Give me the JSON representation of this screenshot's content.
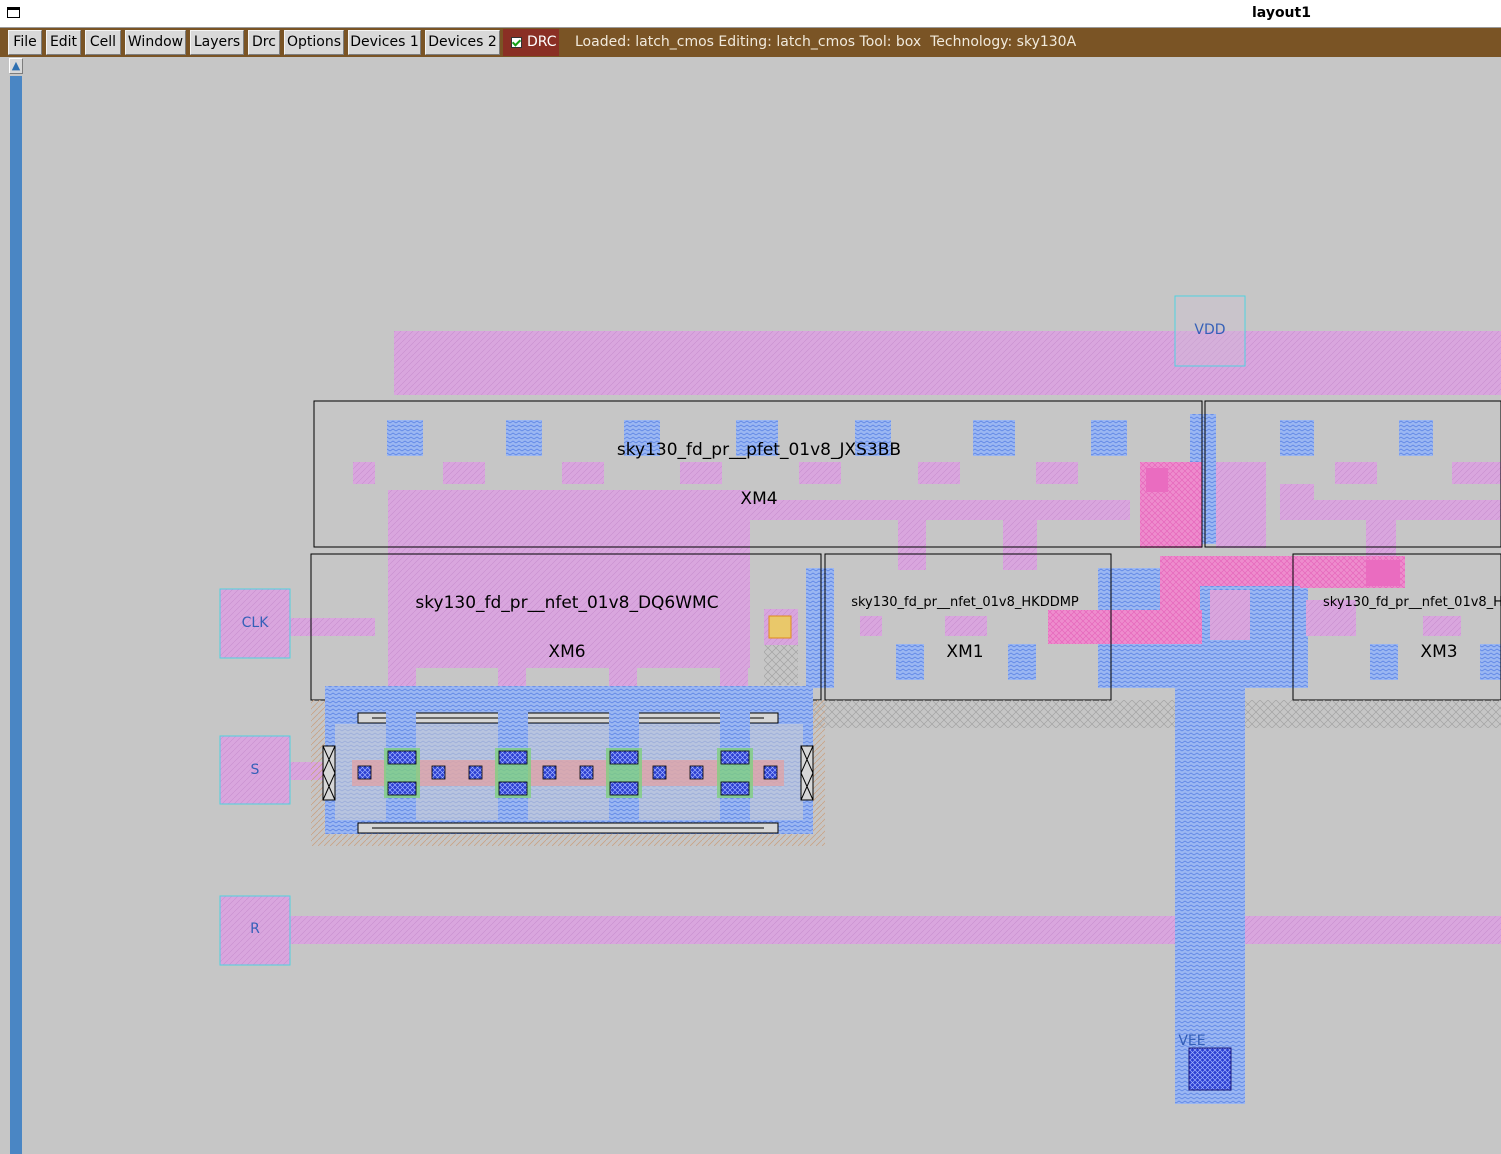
{
  "window": {
    "title": "layout1"
  },
  "menu": [
    "File",
    "Edit",
    "Cell",
    "Window",
    "Layers",
    "Drc",
    "Options",
    "Devices 1",
    "Devices 2"
  ],
  "drc": {
    "label": "DRC",
    "checked": true
  },
  "status": {
    "loaded": "latch_cmos",
    "editing": "latch_cmos",
    "tool": "box",
    "technology": "sky130A",
    "text": "Loaded: latch_cmos Editing: latch_cmos Tool: box  Technology: sky130A"
  },
  "cells": [
    {
      "name": "sky130_fd_pr__pfet_01v8_JXS3BB",
      "instance": "XM4"
    },
    {
      "name": "sky130_fd_pr__nfet_01v8_DQ6WMC",
      "instance": "XM6"
    },
    {
      "name": "sky130_fd_pr__nfet_01v8_HKDDMP",
      "instance": "XM1"
    },
    {
      "name": "sky130_fd_pr__nfet_01v8_H",
      "instance": "XM3"
    }
  ],
  "pins": {
    "vdd": "VDD",
    "clk": "CLK",
    "s": "S",
    "r": "R",
    "vee": "VEE"
  },
  "colors": {
    "background": "#c6c6c6",
    "menubar": "#7a5425",
    "drc_button": "#8a2f24",
    "poly": "#d9a6de",
    "metal1": "#7aa3f2",
    "pin_label": "#3560b8",
    "scrollbar": "#4a86c4"
  }
}
